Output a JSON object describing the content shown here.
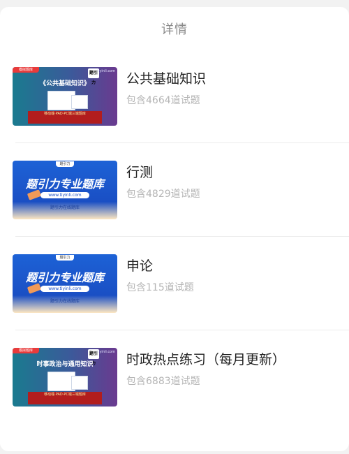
{
  "page": {
    "title": "详情"
  },
  "items": [
    {
      "title": "公共基础知识",
      "subtitle": "包含4664道试题",
      "thumb": {
        "style": "purple",
        "tag": "模拟题库",
        "heading": "《公共基础知识》",
        "logo": "题引力",
        "url": "tiyinli.com",
        "footer": "移动端·PAD·PC端三端题库"
      }
    },
    {
      "title": "行测",
      "subtitle": "包含4829道试题",
      "thumb": {
        "style": "blue",
        "heading": "题引力专业题库",
        "url": "www.tiyinli.com",
        "footer": "题引力在线题库"
      }
    },
    {
      "title": "申论",
      "subtitle": "包含115道试题",
      "thumb": {
        "style": "blue",
        "heading": "题引力专业题库",
        "url": "www.tiyinli.com",
        "footer": "题引力在线题库"
      }
    },
    {
      "title": "时政热点练习（每月更新）",
      "subtitle": "包含6883道试题",
      "thumb": {
        "style": "purple",
        "tag": "模拟题库",
        "heading": "时事政治与通用知识",
        "logo": "题引力",
        "url": "tiyinli.com",
        "footer": "移动端·PAD·PC端三端题库"
      }
    }
  ],
  "colors": {
    "background": "#f2f2f2",
    "card": "#ffffff",
    "title": "#8a8a8a",
    "subtitle": "#b5b5b5"
  }
}
